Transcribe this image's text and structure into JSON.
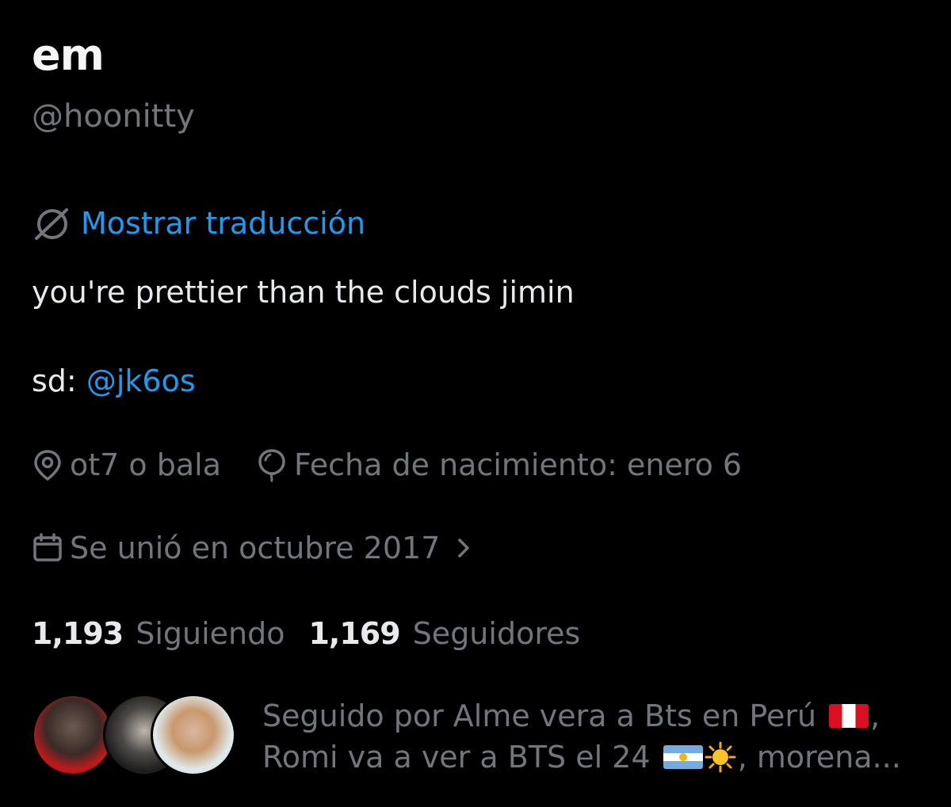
{
  "profile": {
    "name": "em",
    "handle": "@hoonitty",
    "translate_label": "Mostrar traducción",
    "bio_line": "you're prettier than the clouds jimin",
    "sd_prefix": "sd:",
    "sd_mention": "@jk6os",
    "location": "ot7 o bala",
    "birthday": "Fecha de nacimiento: enero 6",
    "joined": "Se unió en octubre 2017"
  },
  "stats": {
    "following_count": "1,193",
    "following_label": "Siguiendo",
    "followers_count": "1,169",
    "followers_label": "Seguidores"
  },
  "followed_by": {
    "prefix": "Seguido por Alme vera a Bts en Perú",
    "sep1": ",",
    "second": "Romi va a ver a BTS el 24",
    "suffix": ", morena..."
  },
  "colors": {
    "background": "#000000",
    "primary_text": "#e7e9ea",
    "secondary_text": "#71767b",
    "accent": "#1d9bf0"
  },
  "icons": [
    "translate-icon",
    "location-icon",
    "birthday-balloon-icon",
    "calendar-icon",
    "chevron-right-icon"
  ]
}
